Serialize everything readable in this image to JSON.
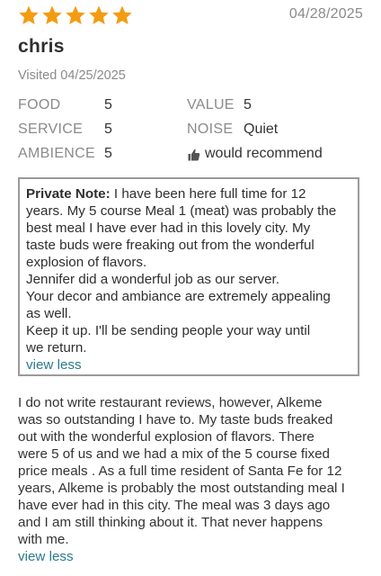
{
  "review": {
    "rating_stars": 5,
    "star_color": "#f39c12",
    "date": "04/28/2025",
    "reviewer": "chris",
    "visited": "Visited 04/25/2025",
    "ratings": {
      "food_label": "FOOD",
      "food_value": "5",
      "service_label": "SERVICE",
      "service_value": "5",
      "ambience_label": "AMBIENCE",
      "ambience_value": "5",
      "value_label": "VALUE",
      "value_value": "5",
      "noise_label": "NOISE",
      "noise_value": "Quiet",
      "recommend_icon": "thumbs-up-icon",
      "recommend_text": "would recommend"
    },
    "private_note": {
      "label": "Private Note:",
      "lines": [
        " I have been here full time for 12",
        "years.  My 5 course Meal 1 (meat) was probably the",
        "best meal I have ever had in this lovely city.  My",
        "taste buds were freaking out from the wonderful",
        "explosion of flavors.",
        "Jennifer did a wonderful job as our server.",
        "Your decor and ambiance are extremely appealing",
        "as well.",
        "Keep it up.  I'll be sending people your way until",
        "we return."
      ],
      "toggle_label": "view less"
    },
    "body": {
      "lines": [
        "I do not write restaurant reviews, however, Alkeme",
        "was so outstanding I have to.  My taste buds freaked",
        "out with the wonderful explosion of flavors. There",
        "were 5 of us and we had a mix of the 5 course fixed",
        "price meals .  As a full time resident of Santa Fe for 12",
        "years, Alkeme is probably the most outstanding meal I",
        "have ever had in this city. The meal was 3 days ago",
        "and I am still thinking about it.  That never happens",
        "with me."
      ],
      "toggle_label": "view less"
    },
    "link_color": "#2a7a8c"
  }
}
